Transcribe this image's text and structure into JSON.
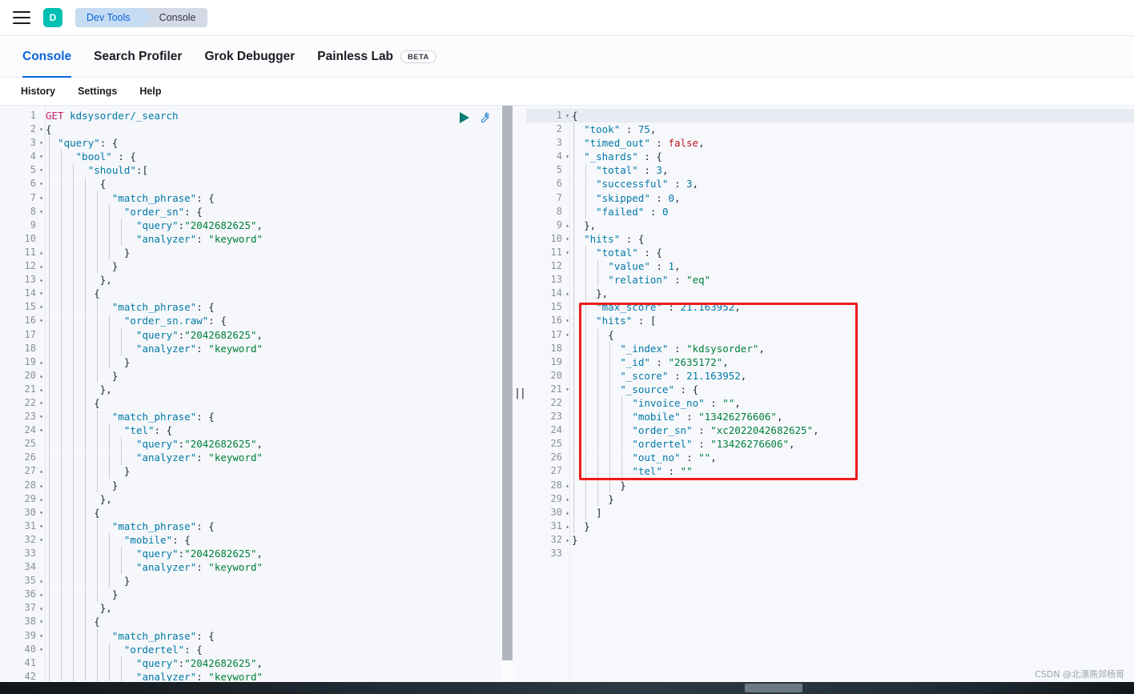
{
  "chrome": {
    "menu_icon": "hamburger-icon",
    "avatar_initial": "D",
    "avatar_color": "#00bfb3",
    "breadcrumbs": [
      {
        "label": "Dev Tools",
        "color": "#0b64dd",
        "bg": "#c6dcf2"
      },
      {
        "label": "Console",
        "color": "#343741",
        "bg": "#d3dae6"
      }
    ]
  },
  "tabs": [
    {
      "label": "Console",
      "active": true
    },
    {
      "label": "Search Profiler",
      "active": false
    },
    {
      "label": "Grok Debugger",
      "active": false
    },
    {
      "label": "Painless Lab",
      "active": false,
      "badge": "BETA"
    }
  ],
  "subtoolbar": [
    {
      "label": "History"
    },
    {
      "label": "Settings"
    },
    {
      "label": "Help"
    }
  ],
  "editor_actions": {
    "run_icon": "play-icon",
    "wrench_icon": "wrench-icon"
  },
  "request": {
    "method": "GET",
    "path": "kdsysorder/_search",
    "search_value": "2042682625",
    "analyzer": "keyword",
    "fields": [
      "order_sn",
      "order_sn.raw",
      "tel",
      "mobile",
      "ordertel"
    ],
    "lines": [
      {
        "n": 1,
        "fold": "",
        "text": "GET kdsysorder/_search",
        "type": "req"
      },
      {
        "n": 2,
        "fold": "v",
        "text": "{"
      },
      {
        "n": 3,
        "fold": "v",
        "text": "  \"query\": {"
      },
      {
        "n": 4,
        "fold": "v",
        "text": "     \"bool\" : {"
      },
      {
        "n": 5,
        "fold": "v",
        "text": "       \"should\":["
      },
      {
        "n": 6,
        "fold": "v",
        "text": "         {"
      },
      {
        "n": 7,
        "fold": "v",
        "text": "           \"match_phrase\": {"
      },
      {
        "n": 8,
        "fold": "v",
        "text": "             \"order_sn\": {"
      },
      {
        "n": 9,
        "fold": "",
        "text": "               \"query\":\"2042682625\","
      },
      {
        "n": 10,
        "fold": "",
        "text": "               \"analyzer\": \"keyword\""
      },
      {
        "n": 11,
        "fold": "^",
        "text": "             }"
      },
      {
        "n": 12,
        "fold": "^",
        "text": "           }"
      },
      {
        "n": 13,
        "fold": "^",
        "text": "         },"
      },
      {
        "n": 14,
        "fold": "v",
        "text": "        {"
      },
      {
        "n": 15,
        "fold": "v",
        "text": "           \"match_phrase\": {"
      },
      {
        "n": 16,
        "fold": "v",
        "text": "             \"order_sn.raw\": {"
      },
      {
        "n": 17,
        "fold": "",
        "text": "               \"query\":\"2042682625\","
      },
      {
        "n": 18,
        "fold": "",
        "text": "               \"analyzer\": \"keyword\""
      },
      {
        "n": 19,
        "fold": "^",
        "text": "             }"
      },
      {
        "n": 20,
        "fold": "^",
        "text": "           }"
      },
      {
        "n": 21,
        "fold": "^",
        "text": "         },"
      },
      {
        "n": 22,
        "fold": "v",
        "text": "        {"
      },
      {
        "n": 23,
        "fold": "v",
        "text": "           \"match_phrase\": {"
      },
      {
        "n": 24,
        "fold": "v",
        "text": "             \"tel\": {"
      },
      {
        "n": 25,
        "fold": "",
        "text": "               \"query\":\"2042682625\","
      },
      {
        "n": 26,
        "fold": "",
        "text": "               \"analyzer\": \"keyword\""
      },
      {
        "n": 27,
        "fold": "^",
        "text": "             }"
      },
      {
        "n": 28,
        "fold": "^",
        "text": "           }"
      },
      {
        "n": 29,
        "fold": "^",
        "text": "         },"
      },
      {
        "n": 30,
        "fold": "v",
        "text": "        {"
      },
      {
        "n": 31,
        "fold": "v",
        "text": "           \"match_phrase\": {"
      },
      {
        "n": 32,
        "fold": "v",
        "text": "             \"mobile\": {"
      },
      {
        "n": 33,
        "fold": "",
        "text": "               \"query\":\"2042682625\","
      },
      {
        "n": 34,
        "fold": "",
        "text": "               \"analyzer\": \"keyword\""
      },
      {
        "n": 35,
        "fold": "^",
        "text": "             }"
      },
      {
        "n": 36,
        "fold": "^",
        "text": "           }"
      },
      {
        "n": 37,
        "fold": "^",
        "text": "         },"
      },
      {
        "n": 38,
        "fold": "v",
        "text": "        {"
      },
      {
        "n": 39,
        "fold": "v",
        "text": "           \"match_phrase\": {"
      },
      {
        "n": 40,
        "fold": "v",
        "text": "             \"ordertel\": {"
      },
      {
        "n": 41,
        "fold": "",
        "text": "               \"query\":\"2042682625\","
      },
      {
        "n": 42,
        "fold": "",
        "text": "               \"analyzer\": \"keyword\""
      }
    ]
  },
  "response": {
    "took": 75,
    "timed_out": false,
    "shards": {
      "total": 3,
      "successful": 3,
      "skipped": 0,
      "failed": 0
    },
    "hits_total": {
      "value": 1,
      "relation": "eq"
    },
    "max_score": 21.163952,
    "hit": {
      "_index": "kdsysorder",
      "_id": "2635172",
      "_score": 21.163952,
      "_source": {
        "invoice_no": "",
        "mobile": "13426276606",
        "order_sn": "xc2022042682625",
        "ordertel": "13426276606",
        "out_no": "",
        "tel": ""
      }
    },
    "lines": [
      {
        "n": 1,
        "fold": "v",
        "text": "{",
        "active": true
      },
      {
        "n": 2,
        "fold": "",
        "text": "  \"took\" : 75,"
      },
      {
        "n": 3,
        "fold": "",
        "text": "  \"timed_out\" : false,"
      },
      {
        "n": 4,
        "fold": "v",
        "text": "  \"_shards\" : {"
      },
      {
        "n": 5,
        "fold": "",
        "text": "    \"total\" : 3,"
      },
      {
        "n": 6,
        "fold": "",
        "text": "    \"successful\" : 3,"
      },
      {
        "n": 7,
        "fold": "",
        "text": "    \"skipped\" : 0,"
      },
      {
        "n": 8,
        "fold": "",
        "text": "    \"failed\" : 0"
      },
      {
        "n": 9,
        "fold": "^",
        "text": "  },"
      },
      {
        "n": 10,
        "fold": "v",
        "text": "  \"hits\" : {"
      },
      {
        "n": 11,
        "fold": "v",
        "text": "    \"total\" : {"
      },
      {
        "n": 12,
        "fold": "",
        "text": "      \"value\" : 1,"
      },
      {
        "n": 13,
        "fold": "",
        "text": "      \"relation\" : \"eq\""
      },
      {
        "n": 14,
        "fold": "^",
        "text": "    },"
      },
      {
        "n": 15,
        "fold": "",
        "text": "    \"max_score\" : 21.163952,"
      },
      {
        "n": 16,
        "fold": "v",
        "text": "    \"hits\" : ["
      },
      {
        "n": 17,
        "fold": "v",
        "text": "      {"
      },
      {
        "n": 18,
        "fold": "",
        "text": "        \"_index\" : \"kdsysorder\","
      },
      {
        "n": 19,
        "fold": "",
        "text": "        \"_id\" : \"2635172\","
      },
      {
        "n": 20,
        "fold": "",
        "text": "        \"_score\" : 21.163952,"
      },
      {
        "n": 21,
        "fold": "v",
        "text": "        \"_source\" : {"
      },
      {
        "n": 22,
        "fold": "",
        "text": "          \"invoice_no\" : \"\","
      },
      {
        "n": 23,
        "fold": "",
        "text": "          \"mobile\" : \"13426276606\","
      },
      {
        "n": 24,
        "fold": "",
        "text": "          \"order_sn\" : \"xc2022042682625\","
      },
      {
        "n": 25,
        "fold": "",
        "text": "          \"ordertel\" : \"13426276606\","
      },
      {
        "n": 26,
        "fold": "",
        "text": "          \"out_no\" : \"\","
      },
      {
        "n": 27,
        "fold": "",
        "text": "          \"tel\" : \"\""
      },
      {
        "n": 28,
        "fold": "^",
        "text": "        }"
      },
      {
        "n": 29,
        "fold": "^",
        "text": "      }"
      },
      {
        "n": 30,
        "fold": "^",
        "text": "    ]"
      },
      {
        "n": 31,
        "fold": "^",
        "text": "  }"
      },
      {
        "n": 32,
        "fold": "^",
        "text": "}"
      },
      {
        "n": 33,
        "fold": "",
        "text": ""
      }
    ]
  },
  "annotation": {
    "shape": "red-rectangle",
    "color": "#ee1b1b",
    "covers_lines": "16-28"
  },
  "watermark": "CSDN @北漂燕郊杨哥"
}
